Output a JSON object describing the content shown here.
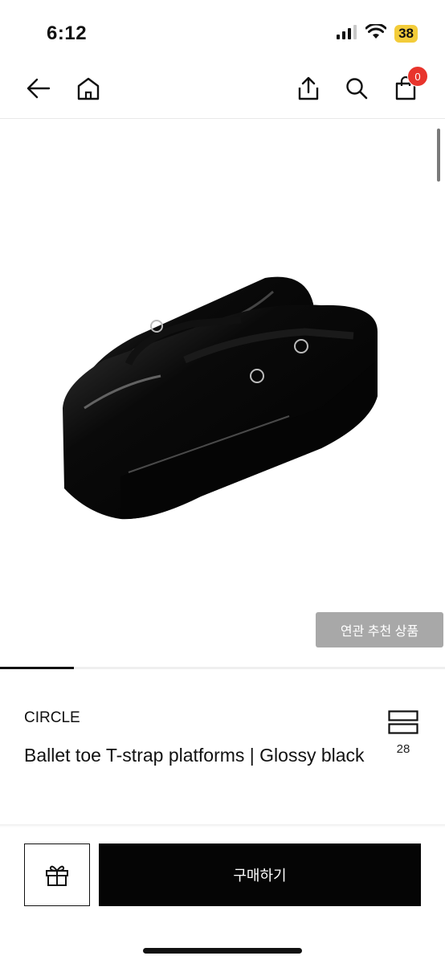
{
  "status_bar": {
    "time": "6:12",
    "battery": "38",
    "icons": [
      "signal-icon",
      "wifi-icon",
      "battery-icon"
    ]
  },
  "nav": {
    "icons": [
      "back-arrow-icon",
      "home-icon",
      "share-icon",
      "search-icon",
      "shopping-bag-icon"
    ],
    "cart_count": "0"
  },
  "gallery": {
    "image_subject": "glossy black T-strap platform shoes",
    "related_button": "연관 추천 상품",
    "progress_fraction": 0.166
  },
  "product": {
    "brand": "CIRCLE",
    "title": "Ballet toe T-strap platforms | Glossy black",
    "compare_count": "28"
  },
  "actions": {
    "gift_icon": "gift-icon",
    "buy_label": "구매하기"
  },
  "colors": {
    "badge": "#e8342c",
    "buy_button": "#050505",
    "related_button": "#a8a8a8",
    "battery": "#f3cc3a"
  }
}
